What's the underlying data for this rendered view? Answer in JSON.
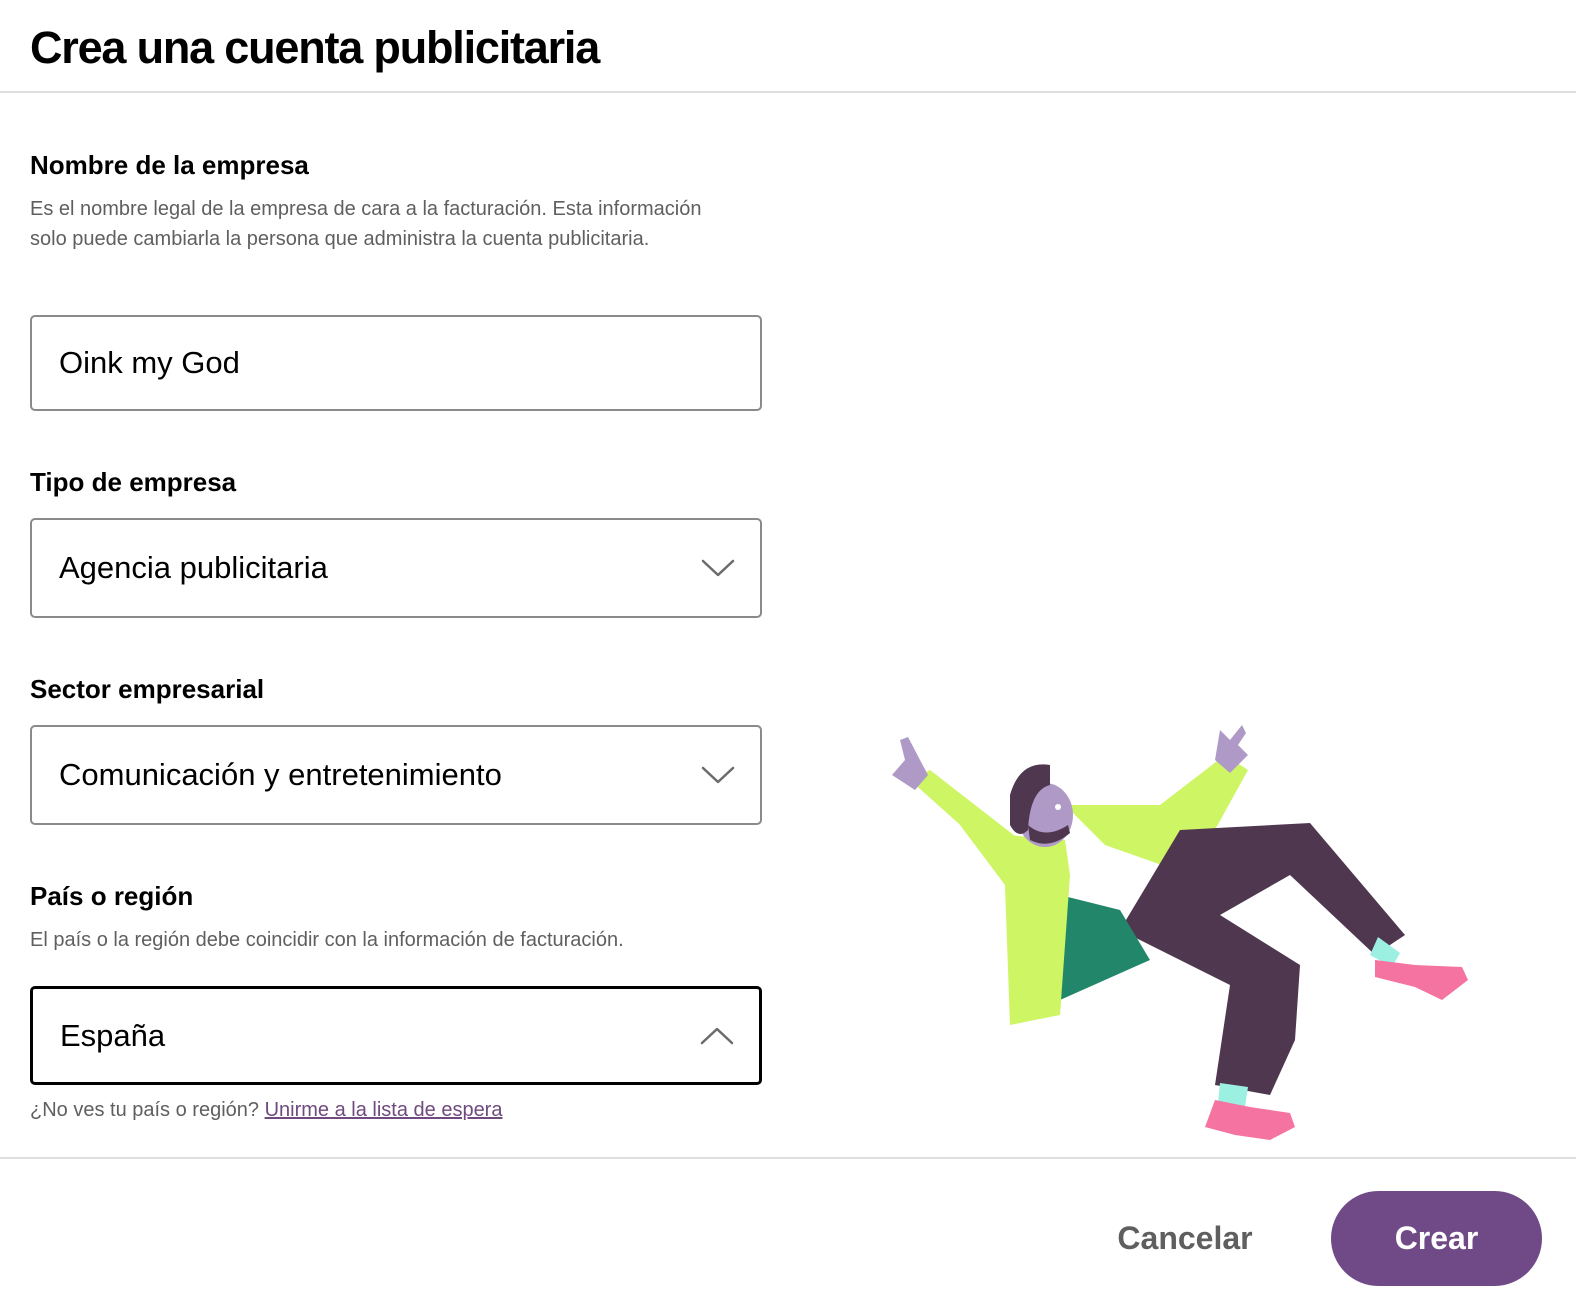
{
  "header": {
    "title": "Crea una cuenta publicitaria"
  },
  "form": {
    "company_name": {
      "label": "Nombre de la empresa",
      "help": "Es el nombre legal de la empresa de cara a la facturación. Esta información solo puede cambiarla la persona que administra la cuenta publicitaria.",
      "value": "Oink my God"
    },
    "company_type": {
      "label": "Tipo de empresa",
      "selected": "Agencia publicitaria",
      "icon": "chevron-down-icon"
    },
    "industry": {
      "label": "Sector empresarial",
      "selected": "Comunicación y entretenimiento",
      "icon": "chevron-down-icon"
    },
    "country": {
      "label": "País o región",
      "help": "El país o la región debe coincidir con la información de facturación.",
      "selected": "España",
      "icon": "chevron-up-icon",
      "state": "open"
    },
    "waitlist": {
      "prompt": "¿No ves tu país o región?",
      "link": "Unirme a la lista de espera"
    }
  },
  "footer": {
    "cancel_label": "Cancelar",
    "create_label": "Crear"
  },
  "colors": {
    "primary": "#6f4a86",
    "link": "#6f4a7e",
    "muted_text": "#5f5f5f",
    "border": "#8a8a8a",
    "divider": "#dedede"
  }
}
